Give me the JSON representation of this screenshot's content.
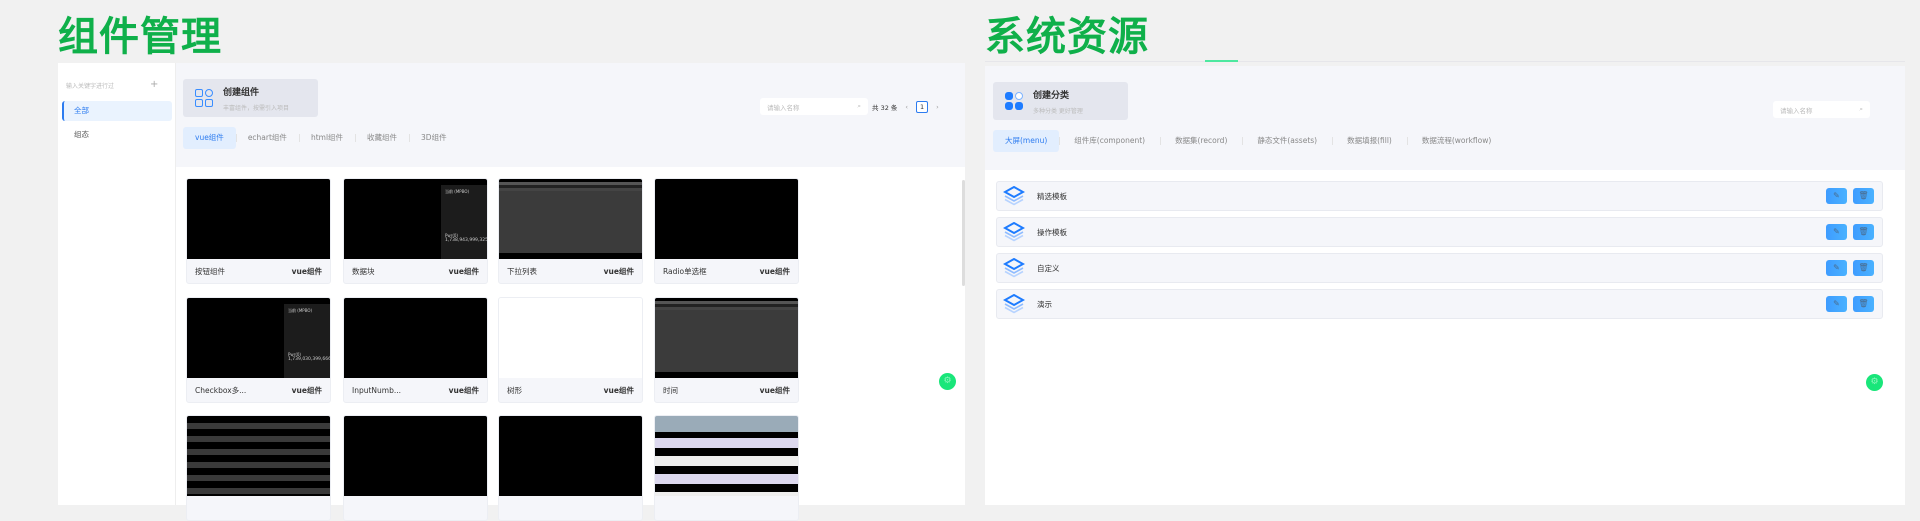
{
  "left": {
    "title": "组件管理",
    "sidebar": {
      "search_placeholder": "输入关键字进行过",
      "add": "+",
      "items": [
        {
          "label": "全部",
          "active": true
        },
        {
          "label": "组态"
        }
      ]
    },
    "create": {
      "title": "创建组件",
      "subtitle": "丰富组件，按需引入项目"
    },
    "tabs": [
      {
        "label": "vue组件",
        "active": true
      },
      {
        "label": "echart组件"
      },
      {
        "label": "html组件"
      },
      {
        "label": "收藏组件"
      },
      {
        "label": "3D组件"
      }
    ],
    "search_placeholder": "请输入名称",
    "pagination": {
      "total": "共 32 条",
      "prev": "‹",
      "page": "1",
      "next": "›"
    },
    "cards": [
      {
        "name": "按钮组件",
        "type": "vue组件",
        "preview": "black"
      },
      {
        "name": "数据块",
        "type": "vue组件",
        "preview": "datablock",
        "info_title": "当前 (MPBO)",
        "info_label": "Pwr(0)",
        "info_value": "1,738,943,999,325"
      },
      {
        "name": "下拉列表",
        "type": "vue组件",
        "preview": "gray"
      },
      {
        "name": "Radio单选框",
        "type": "vue组件",
        "preview": "black"
      },
      {
        "name": "Checkbox多...",
        "type": "vue组件",
        "preview": "datablock",
        "info_title": "当前 (MPBO)",
        "info_label": "Pwr(0)",
        "info_value": "1,739,030,399,666"
      },
      {
        "name": "InputNumb...",
        "type": "vue组件",
        "preview": "black"
      },
      {
        "name": "树形",
        "type": "vue组件",
        "preview": "white"
      },
      {
        "name": "时间",
        "type": "vue组件",
        "preview": "gray"
      },
      {
        "preview": "stripes"
      },
      {
        "preview": "black"
      },
      {
        "preview": "black"
      },
      {
        "preview": "table"
      }
    ]
  },
  "right": {
    "title": "系统资源",
    "create": {
      "title": "创建分类",
      "subtitle": "多种分类 更好管理"
    },
    "tabs": [
      {
        "label": "大屏(menu)",
        "active": true
      },
      {
        "label": "组件库(component)"
      },
      {
        "label": "数据集(record)"
      },
      {
        "label": "静态文件(assets)"
      },
      {
        "label": "数据填报(fill)"
      },
      {
        "label": "数据流程(workflow)"
      }
    ],
    "search_placeholder": "请输入名称",
    "rows": [
      {
        "name": "精选模板"
      },
      {
        "name": "操作模板"
      },
      {
        "name": "自定义"
      },
      {
        "name": "演示"
      }
    ]
  },
  "colors": {
    "title_green": "#0fb04a",
    "accent_blue": "#2d7cf0",
    "fab_green": "#19e67a"
  }
}
